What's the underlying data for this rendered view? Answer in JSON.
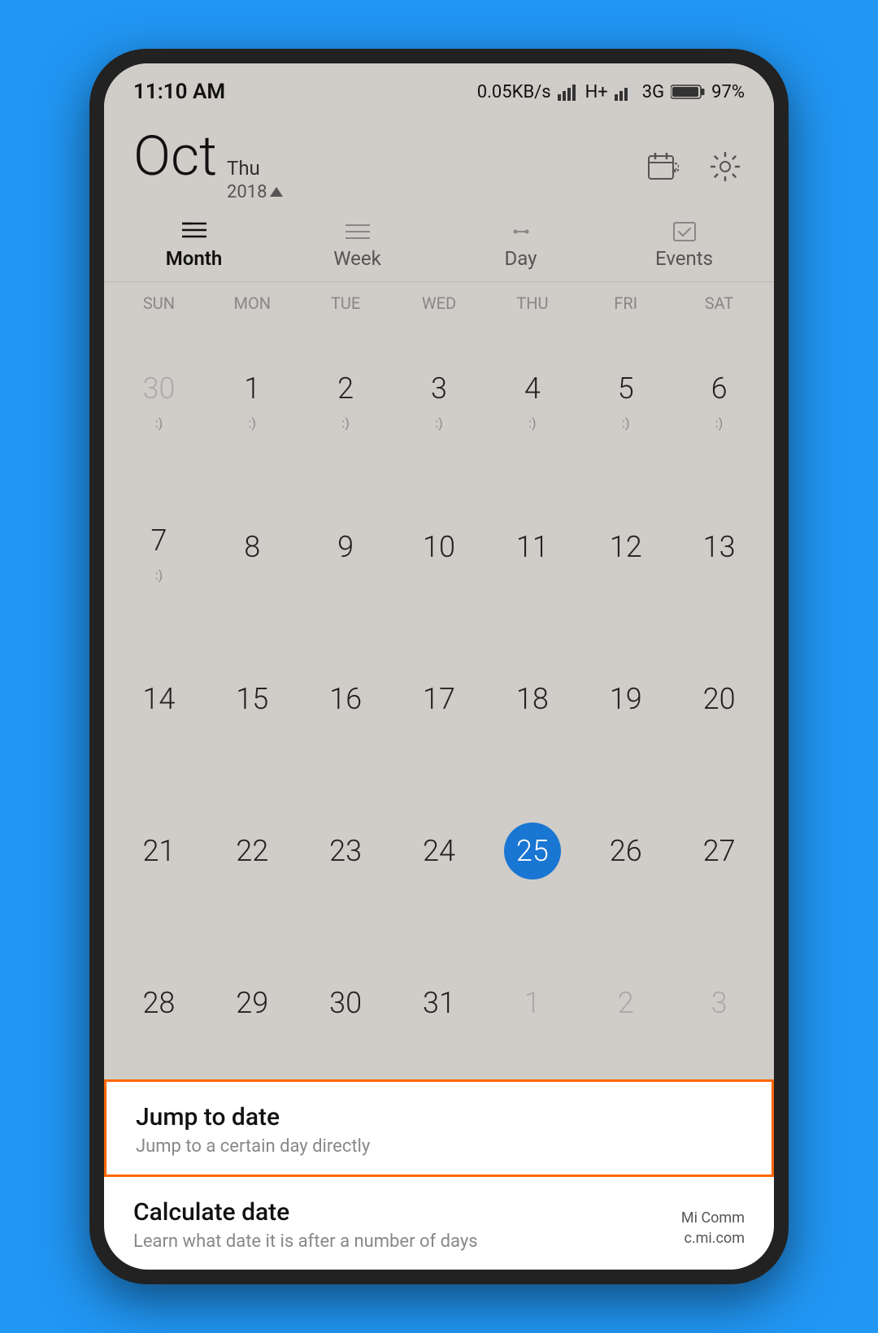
{
  "status": {
    "time": "11:10  AM",
    "network": "0.05KB/s",
    "signal": "H+",
    "carrier": "3G",
    "battery": "97%"
  },
  "header": {
    "month_short": "Oct",
    "day_of_week": "Thu",
    "year": "2018",
    "calendar_icon_label": "calendar",
    "settings_icon_label": "settings"
  },
  "view_tabs": [
    {
      "id": "month",
      "label": "Month",
      "active": true
    },
    {
      "id": "week",
      "label": "Week",
      "active": false
    },
    {
      "id": "day",
      "label": "Day",
      "active": false
    },
    {
      "id": "events",
      "label": "Events",
      "active": false
    }
  ],
  "day_headers": [
    "SUN",
    "MON",
    "TUE",
    "WED",
    "THU",
    "FRI",
    "SAT"
  ],
  "weeks": [
    [
      {
        "num": "30",
        "other": true,
        "dot": true
      },
      {
        "num": "1",
        "other": false,
        "dot": true
      },
      {
        "num": "2",
        "other": false,
        "dot": true
      },
      {
        "num": "3",
        "other": false,
        "dot": true
      },
      {
        "num": "4",
        "other": false,
        "dot": true
      },
      {
        "num": "5",
        "other": false,
        "dot": true
      },
      {
        "num": "6",
        "other": false,
        "dot": true
      }
    ],
    [
      {
        "num": "7",
        "other": false,
        "dot": true
      },
      {
        "num": "8",
        "other": false,
        "dot": false
      },
      {
        "num": "9",
        "other": false,
        "dot": false
      },
      {
        "num": "10",
        "other": false,
        "dot": false
      },
      {
        "num": "11",
        "other": false,
        "dot": false
      },
      {
        "num": "12",
        "other": false,
        "dot": false
      },
      {
        "num": "13",
        "other": false,
        "dot": false
      }
    ],
    [
      {
        "num": "14",
        "other": false,
        "dot": false
      },
      {
        "num": "15",
        "other": false,
        "dot": false
      },
      {
        "num": "16",
        "other": false,
        "dot": false
      },
      {
        "num": "17",
        "other": false,
        "dot": false
      },
      {
        "num": "18",
        "other": false,
        "dot": false
      },
      {
        "num": "19",
        "other": false,
        "dot": false
      },
      {
        "num": "20",
        "other": false,
        "dot": false
      }
    ],
    [
      {
        "num": "21",
        "other": false,
        "dot": false
      },
      {
        "num": "22",
        "other": false,
        "dot": false
      },
      {
        "num": "23",
        "other": false,
        "dot": false
      },
      {
        "num": "24",
        "other": false,
        "dot": false
      },
      {
        "num": "25",
        "other": false,
        "today": true,
        "dot": false
      },
      {
        "num": "26",
        "other": false,
        "dot": false
      },
      {
        "num": "27",
        "other": false,
        "dot": false
      }
    ],
    [
      {
        "num": "28",
        "other": false,
        "dot": false
      },
      {
        "num": "29",
        "other": false,
        "dot": false
      },
      {
        "num": "30",
        "other": false,
        "dot": false
      },
      {
        "num": "31",
        "other": false,
        "dot": false
      },
      {
        "num": "1",
        "other": true,
        "dot": false
      },
      {
        "num": "2",
        "other": true,
        "dot": false
      },
      {
        "num": "3",
        "other": true,
        "dot": false
      }
    ]
  ],
  "menu_items": [
    {
      "id": "jump-to-date",
      "title": "Jump to date",
      "subtitle": "Jump to a certain day directly",
      "highlighted": true
    },
    {
      "id": "calculate-date",
      "title": "Calculate date",
      "subtitle": "Learn what date it is after a number of days",
      "highlighted": false
    }
  ],
  "watermark": {
    "line1": "Mi Comm",
    "line2": "c.mi.com"
  }
}
